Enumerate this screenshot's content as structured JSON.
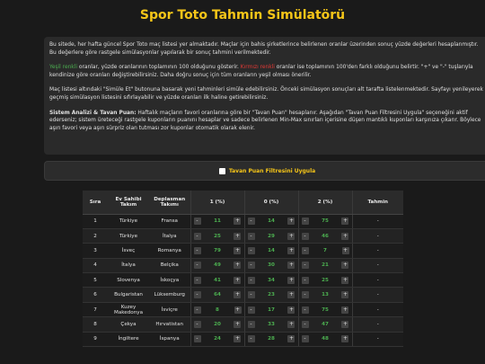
{
  "page": {
    "title": "Spor Toto Tahmin Simülatörü"
  },
  "info": {
    "p1": "Bu sitede, her hafta güncel Spor Toto maç listesi yer almaktadır. Maçlar için bahis şirketlerince belirlenen oranlar üzerinden sonuç yüzde değerleri hesaplanmıştır. Bu değerlere göre rastgele simülasyonlar yapılarak bir sonuç tahmini verilmektedir.",
    "p2_green": "Yeşil renkli",
    "p2_mid": " oranlar, yüzde oranlarının toplamının 100 olduğunu gösterir. ",
    "p2_red": "Kırmızı renkli",
    "p2_end": " oranlar ise toplamının 100'den farklı olduğunu belirtir. \"+\" ve \"-\" tuşlarıyla kendinize göre oranları değiştirebilirsiniz. Daha doğru sonuç için tüm oranların yeşil olması önerilir.",
    "p3": "Maç listesi altındaki \"Simüle Et\" butonuna basarak yeni tahminleri simüle edebilirsiniz. Önceki simülasyon sonuçları alt tarafta listelenmektedir. Sayfayı yenileyerek geçmiş simülasyon listesini sıfırlayabilir ve yüzde oranları ilk haline getirebilirsiniz.",
    "p4_bold": "Sistem Analizi & Tavan Puan:",
    "p4_rest": " Haftalık maçların favori oranlarına göre bir \"Tavan Puan\" hesaplanır. Aşağıdan \"Tavan Puan Filtresini Uygula\" seçeneğini aktif ederseniz; sistem üreteceği rastgele kuponların puanını hesaplar ve sadece belirlenen Min-Max sınırları içerisine düşen mantıklı kuponları karşınıza çıkarır. Böylece aşırı favori veya aşırı sürpriz olan tutması zor kuponlar otomatik olarak elenir."
  },
  "filter": {
    "label": "Tavan Puan Filtresini Uygula"
  },
  "table": {
    "headers": {
      "no": "Sıra",
      "home": "Ev Sahibi Takım",
      "away": "Deplasman Takımı",
      "one": "1 (%)",
      "zero": "0 (%)",
      "two": "2 (%)",
      "pred": "Tahmin"
    },
    "minus": "-",
    "plus": "+",
    "rows": [
      {
        "no": "1",
        "home": "Türkiye",
        "away": "Fransa",
        "one": "11",
        "zero": "14",
        "two": "75",
        "pred": "-"
      },
      {
        "no": "2",
        "home": "Türkiye",
        "away": "İtalya",
        "one": "25",
        "zero": "29",
        "two": "46",
        "pred": "-"
      },
      {
        "no": "3",
        "home": "İsveç",
        "away": "Romanya",
        "one": "79",
        "zero": "14",
        "two": "7",
        "pred": "-"
      },
      {
        "no": "4",
        "home": "İtalya",
        "away": "Belçika",
        "one": "49",
        "zero": "30",
        "two": "21",
        "pred": "-"
      },
      {
        "no": "5",
        "home": "Slovenya",
        "away": "İskoçya",
        "one": "41",
        "zero": "34",
        "two": "25",
        "pred": "-"
      },
      {
        "no": "6",
        "home": "Bulgaristan",
        "away": "Lüksemburg",
        "one": "64",
        "zero": "23",
        "two": "13",
        "pred": "-"
      },
      {
        "no": "7",
        "home": "Kuzey Makedonya",
        "away": "İsviçre",
        "one": "8",
        "zero": "17",
        "two": "75",
        "pred": "-"
      },
      {
        "no": "8",
        "home": "Çekya",
        "away": "Hırvatistan",
        "one": "20",
        "zero": "33",
        "two": "47",
        "pred": "-"
      },
      {
        "no": "9",
        "home": "İngiltere",
        "away": "İspanya",
        "one": "24",
        "zero": "28",
        "two": "48",
        "pred": "-"
      }
    ]
  }
}
